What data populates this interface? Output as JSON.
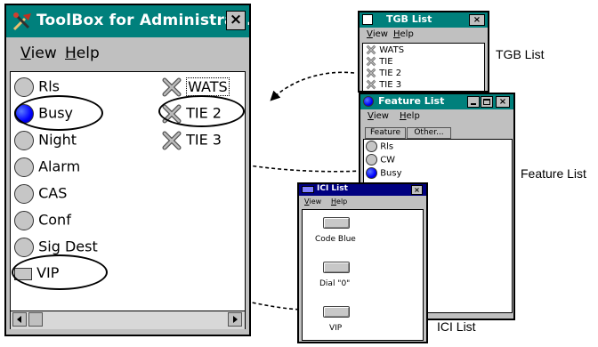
{
  "toolbox": {
    "title": "ToolBox for Administra...",
    "close": "×",
    "menu_view_first": "V",
    "menu_view_rest": "iew",
    "menu_help_first": "H",
    "menu_help_rest": "elp",
    "status_items": [
      "Rls",
      "Busy",
      "Night",
      "Alarm",
      "CAS",
      "Conf",
      "Sig Dest",
      "VIP"
    ],
    "trunk_items": [
      "WATS",
      "TIE 2",
      "TIE 3"
    ]
  },
  "tgb": {
    "title": "TGB List",
    "close": "×",
    "menu_view_first": "V",
    "menu_view_rest": "iew",
    "menu_help_first": "H",
    "menu_help_rest": "elp",
    "items": [
      "WATS",
      "TIE",
      "TIE 2",
      "TIE 3"
    ],
    "caption": "TGB List"
  },
  "feature": {
    "title": "Feature List",
    "close": "×",
    "menu_view_first": "V",
    "menu_view_rest": "iew",
    "menu_help_first": "H",
    "menu_help_rest": "elp",
    "tabs": [
      "Feature",
      "Other..."
    ],
    "items": [
      "Rls",
      "CW",
      "Busy"
    ],
    "caption": "Feature List"
  },
  "ici": {
    "title": "ICI List",
    "close": "×",
    "menu_view_first": "V",
    "menu_view_rest": "iew",
    "menu_help_first": "H",
    "menu_help_rest": "elp",
    "buttons": [
      "Code Blue",
      "Dial \"0\"",
      "VIP"
    ],
    "caption": "ICI List"
  },
  "colors": {
    "title_teal": "#00807c",
    "title_navy": "#000080",
    "busy_blue": "#0000ff",
    "window_gray": "#c0c0c0"
  }
}
